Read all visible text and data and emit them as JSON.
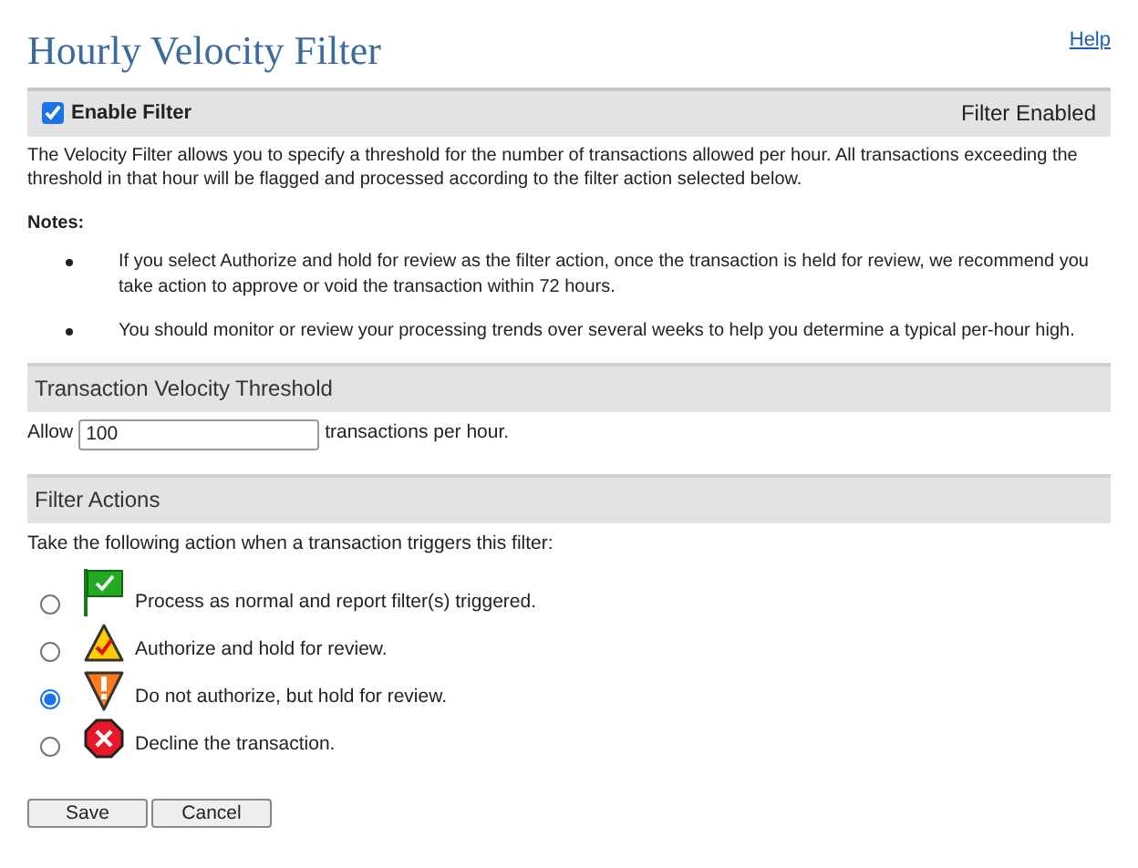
{
  "title": "Hourly Velocity Filter",
  "help_link": "Help",
  "enable": {
    "label": "Enable Filter",
    "checked": true,
    "status": "Filter Enabled"
  },
  "description": "The Velocity Filter allows you to specify a threshold for the number of transactions allowed per hour. All transactions exceeding the threshold in that hour will be flagged and processed according to the filter action selected below.",
  "notes_heading": "Notes:",
  "notes": [
    "If you select Authorize and hold for review as the filter action, once the transaction is held for review, we recommend you take action to approve or void the transaction within 72 hours.",
    "You should monitor or review your processing trends over several weeks to help you determine a typical per-hour high."
  ],
  "threshold": {
    "heading": "Transaction Velocity Threshold",
    "prefix": "Allow",
    "value": "100",
    "suffix": "transactions per hour."
  },
  "actions": {
    "heading": "Filter Actions",
    "intro": "Take the following action when a transaction triggers this filter:",
    "options": [
      {
        "kind": "flag",
        "label": "Process as normal and report filter(s) triggered.",
        "selected": false
      },
      {
        "kind": "caution",
        "label": "Authorize and hold for review.",
        "selected": false
      },
      {
        "kind": "warning",
        "label": "Do not authorize, but hold for review.",
        "selected": true
      },
      {
        "kind": "decline",
        "label": "Decline the transaction.",
        "selected": false
      }
    ]
  },
  "buttons": [
    "Save",
    "Cancel"
  ]
}
